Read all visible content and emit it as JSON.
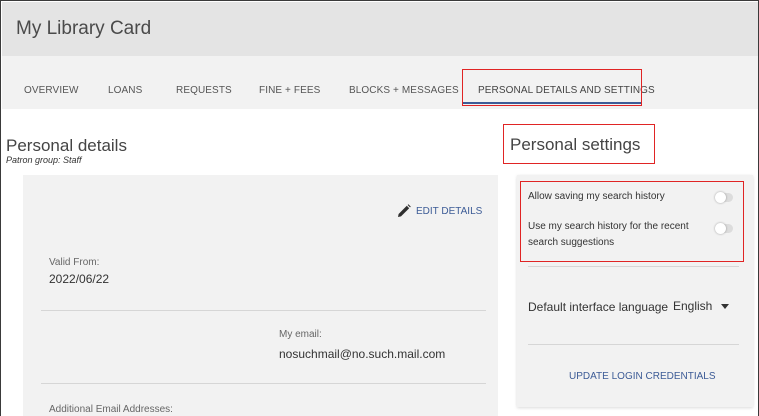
{
  "page": {
    "title": "My Library Card"
  },
  "tabs": [
    {
      "label": "OVERVIEW"
    },
    {
      "label": "LOANS"
    },
    {
      "label": "REQUESTS"
    },
    {
      "label": "FINE + FEES"
    },
    {
      "label": "BLOCKS + MESSAGES"
    },
    {
      "label": "PERSONAL DETAILS AND SETTINGS",
      "active": true
    }
  ],
  "personal_details": {
    "title": "Personal details",
    "patron_group": "Patron group: Staff",
    "edit_label": "EDIT DETAILS",
    "edit_icon": "pencil-icon",
    "valid_from": {
      "label": "Valid From:",
      "value": "2022/06/22"
    },
    "email": {
      "label": "My email:",
      "value": "nosuchmail@no.such.mail.com"
    },
    "additional_email": {
      "label": "Additional Email Addresses:"
    }
  },
  "personal_settings": {
    "title": "Personal settings",
    "allow_history": {
      "label": "Allow saving my search history",
      "enabled": false
    },
    "use_history": {
      "label": "Use my search history for the recent search suggestions",
      "enabled": false
    },
    "language": {
      "label": "Default interface language",
      "value": "English"
    },
    "update_credentials_label": "UPDATE LOGIN CREDENTIALS"
  },
  "colors": {
    "accent": "#3c5b96",
    "highlight_border": "#e02424",
    "panel_background": "#f2f2f2"
  }
}
